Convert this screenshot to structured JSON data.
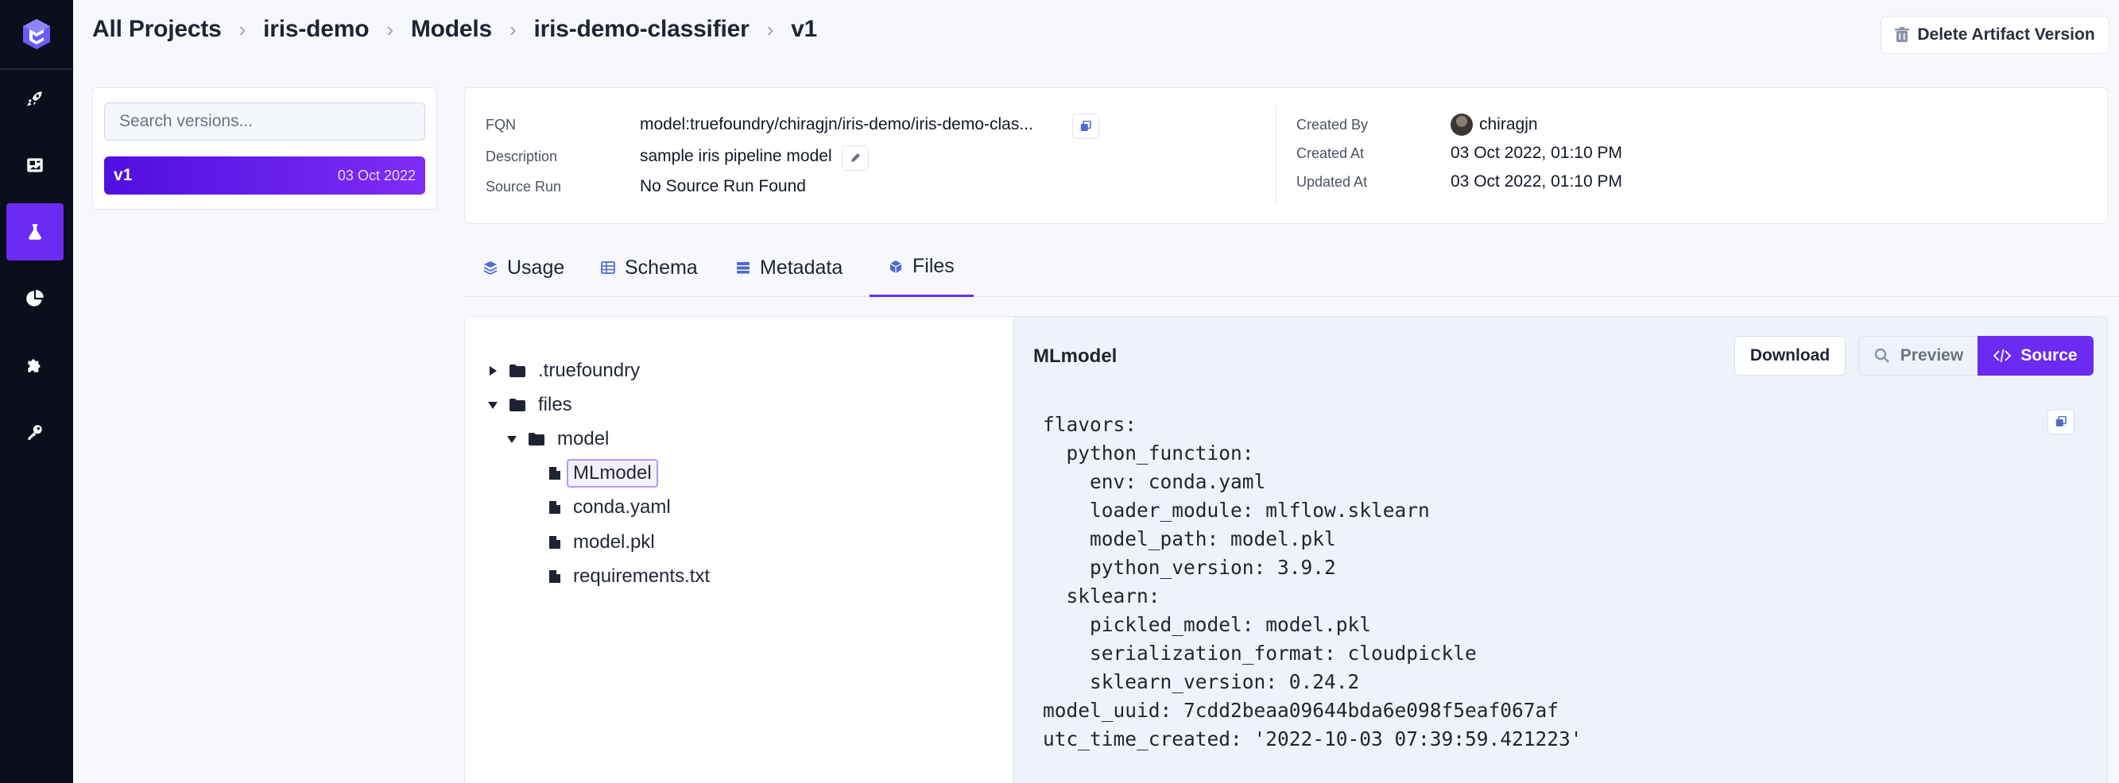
{
  "breadcrumb": [
    "All Projects",
    "iris-demo",
    "Models",
    "iris-demo-classifier",
    "v1"
  ],
  "header": {
    "delete_label": "Delete Artifact Version"
  },
  "versions": {
    "search_placeholder": "Search versions...",
    "items": [
      {
        "name": "v1",
        "date": "03 Oct 2022",
        "selected": true
      }
    ]
  },
  "info": {
    "fqn_label": "FQN",
    "fqn_value": "model:truefoundry/chiragjn/iris-demo/iris-demo-clas...",
    "description_label": "Description",
    "description_value": "sample iris pipeline model",
    "source_run_label": "Source Run",
    "source_run_value": "No Source Run Found",
    "created_by_label": "Created By",
    "created_by_value": "chiragjn",
    "created_at_label": "Created At",
    "created_at_value": "03 Oct 2022, 01:10 PM",
    "updated_at_label": "Updated At",
    "updated_at_value": "03 Oct 2022, 01:10 PM"
  },
  "tabs": [
    {
      "label": "Usage",
      "icon": "layers-icon"
    },
    {
      "label": "Schema",
      "icon": "table-icon"
    },
    {
      "label": "Metadata",
      "icon": "database-icon"
    },
    {
      "label": "Files",
      "icon": "cube-icon",
      "active": true
    }
  ],
  "file_tree": [
    {
      "label": ".truefoundry",
      "type": "folder",
      "expanded": false,
      "depth": 0
    },
    {
      "label": "files",
      "type": "folder",
      "expanded": true,
      "depth": 0
    },
    {
      "label": "model",
      "type": "folder",
      "expanded": true,
      "depth": 1
    },
    {
      "label": "MLmodel",
      "type": "file",
      "depth": 2,
      "selected": true
    },
    {
      "label": "conda.yaml",
      "type": "file",
      "depth": 2
    },
    {
      "label": "model.pkl",
      "type": "file",
      "depth": 2
    },
    {
      "label": "requirements.txt",
      "type": "file",
      "depth": 2
    }
  ],
  "viewer": {
    "title": "MLmodel",
    "download_label": "Download",
    "preview_label": "Preview",
    "source_label": "Source",
    "content": "flavors:\n  python_function:\n    env: conda.yaml\n    loader_module: mlflow.sklearn\n    model_path: model.pkl\n    python_version: 3.9.2\n  sklearn:\n    pickled_model: model.pkl\n    serialization_format: cloudpickle\n    sklearn_version: 0.24.2\nmodel_uuid: 7cdd2beaa09644bda6e098f5eaf067af\nutc_time_created: '2022-10-03 07:39:59.421223'"
  },
  "colors": {
    "accent": "#6a2bf2",
    "rail": "#0b0e1b"
  }
}
